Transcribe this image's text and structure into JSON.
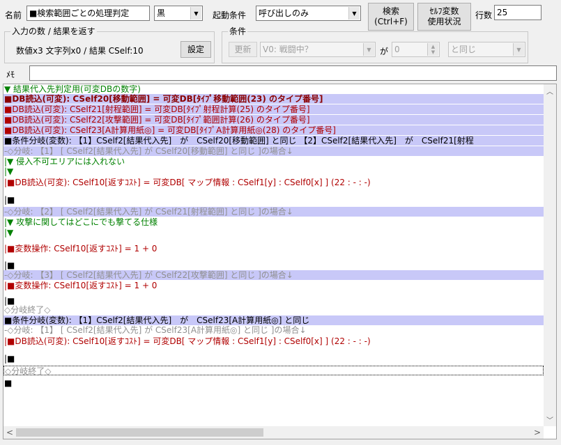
{
  "top": {
    "name_label": "名前",
    "name_value": "■検索範囲ごとの処理判定",
    "color_value": "黒",
    "trigger_label": "起動条件",
    "trigger_value": "呼び出しのみ",
    "search_btn": [
      "検索",
      "(Ctrl+F)"
    ],
    "selfvar_btn": [
      "ｾﾙﾌ変数",
      "使用状況"
    ],
    "rows_label": "行数",
    "rows_value": "25"
  },
  "io_group": {
    "title": "入力の数 / 結果を返す",
    "text": "数値x3 文字列x0 / 結果 CSelf:10",
    "set_btn": "設定"
  },
  "cond_group": {
    "title": "条件",
    "update_btn": "更新",
    "var_value": "V0: 戦闘中？",
    "ga_label": "が",
    "num_value": "0",
    "op_value": "と同じ"
  },
  "memo": {
    "label": "ﾒﾓ",
    "value": ""
  },
  "event_lines": [
    {
      "text": "▼ 結果代入先判定用(可変DBの数字)",
      "color": "green",
      "hl": false
    },
    {
      "text": "■DB読込(可変): CSelf20[移動範囲] = 可変DB[ﾀｲﾌﾟ移動範囲(23) のタイプ番号]",
      "color": "dred",
      "hl": true
    },
    {
      "text": "■DB読込(可変): CSelf21[射程範囲] = 可変DB[ﾀｲﾌﾟ射程計算(25) のタイプ番号]",
      "color": "red",
      "hl": true
    },
    {
      "text": "■DB読込(可変): CSelf22[攻撃範囲] = 可変DB[ﾀｲﾌﾟ範囲計算(26) のタイプ番号]",
      "color": "red",
      "hl": true
    },
    {
      "text": "■DB読込(可変): CSelf23[A計算用紙◎] = 可変DB[ﾀｲﾌﾟA計算用紙◎(28) のタイプ番号]",
      "color": "red",
      "hl": true
    },
    {
      "text": "■条件分岐(変数): 【1】CSelf2[結果代入先]　が　CSelf20[移動範囲] と同じ 【2】CSelf2[結果代入先]　が　CSelf21[射程",
      "color": "black",
      "hl": true
    },
    {
      "text": "-◇分岐: 【1】 [ CSelf2[結果代入先] が CSelf20[移動範囲] と同じ ]の場合↓",
      "color": "gray",
      "hl": true
    },
    {
      "text": "|▼ 侵入不可エリアには入れない",
      "color": "green",
      "hl": false
    },
    {
      "text": "|▼",
      "color": "green",
      "hl": false
    },
    {
      "text": "|■DB読込(可変): CSelf10[返すｺｽﾄ] = 可変DB[ マップ情報 : CSelf1[y] : CSelf0[x] ]  (22 : - : -)",
      "color": "red",
      "hl": false
    },
    {
      "text": "|■",
      "color": "black",
      "hl": false
    },
    {
      "text": "-◇分岐: 【2】 [ CSelf2[結果代入先] が CSelf21[射程範囲] と同じ ]の場合↓",
      "color": "gray",
      "hl": true
    },
    {
      "text": "|▼ 攻撃に関してはどこにでも撃てる仕様",
      "color": "green",
      "hl": false
    },
    {
      "text": "|▼",
      "color": "green",
      "hl": false
    },
    {
      "text": "|■変数操作: CSelf10[返すｺｽﾄ] = 1 + 0",
      "color": "red",
      "hl": false
    },
    {
      "text": "|■",
      "color": "black",
      "hl": false
    },
    {
      "text": "-◇分岐: 【3】 [ CSelf2[結果代入先] が CSelf22[攻撃範囲] と同じ ]の場合↓",
      "color": "gray",
      "hl": true
    },
    {
      "text": "|■変数操作: CSelf10[返すｺｽﾄ] = 1 + 0",
      "color": "red",
      "hl": false
    },
    {
      "text": "|■",
      "color": "black",
      "hl": false
    },
    {
      "text": "◇分岐終了◇",
      "color": "gray",
      "hl": false
    },
    {
      "text": "■条件分岐(変数): 【1】CSelf2[結果代入先]　が　CSelf23[A計算用紙◎] と同じ",
      "color": "black",
      "hl": true
    },
    {
      "text": "-◇分岐: 【1】 [ CSelf2[結果代入先] が CSelf23[A計算用紙◎] と同じ ]の場合↓",
      "color": "gray",
      "hl": false
    },
    {
      "text": "|■DB読込(可変): CSelf10[返すｺｽﾄ] = 可変DB[ マップ情報 : CSelf1[y] : CSelf0[x] ]  (22 : - : -)",
      "color": "red",
      "hl": false
    },
    {
      "text": "|■",
      "color": "black",
      "hl": false
    },
    {
      "text": "◇分岐終了◇",
      "color": "gray",
      "hl": false,
      "dotted": true
    },
    {
      "text": "■",
      "color": "black",
      "hl": false
    }
  ],
  "icons": {
    "dropdown": "chevron-down-icon",
    "spin": "spinner-icon",
    "scroll_up": "scroll-up-icon",
    "scroll_down": "scroll-down-icon",
    "scroll_left": "scroll-left-icon",
    "scroll_right": "scroll-right-icon"
  }
}
